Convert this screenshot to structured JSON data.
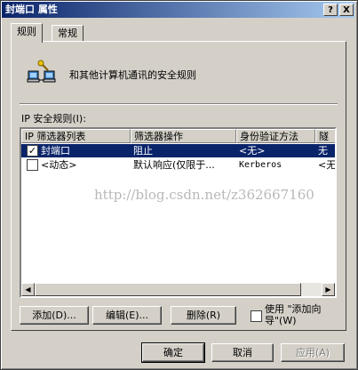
{
  "window": {
    "title": "封端口 属性",
    "help_btn": "?",
    "close_btn": "X"
  },
  "tabs": [
    {
      "label": "规则",
      "active": true
    },
    {
      "label": "常规",
      "active": false
    }
  ],
  "description": "和其他计算机通讯的安全规则",
  "rules_label": "IP 安全规则(I):",
  "columns": [
    "IP 筛选器列表",
    "筛选器操作",
    "身份验证方法",
    "隧"
  ],
  "rows": [
    {
      "checked": true,
      "selected": true,
      "cells": [
        "封端口",
        "阻止",
        "<无>",
        "无"
      ]
    },
    {
      "checked": false,
      "selected": false,
      "cells": [
        "<动态>",
        "默认响应(仅限于...",
        "Kerberos",
        "<无"
      ]
    }
  ],
  "scroll": {
    "left_arrow": "◀",
    "right_arrow": "▶"
  },
  "buttons": {
    "add": "添加(D)...",
    "edit": "编辑(E)...",
    "remove": "删除(R)",
    "wizard_line1": "使用 \"添加向",
    "wizard_line2": "导\"(W)"
  },
  "footer": {
    "ok": "确定",
    "cancel": "取消",
    "apply": "应用(A)"
  },
  "watermark": "http://blog.csdn.net/z362667160"
}
